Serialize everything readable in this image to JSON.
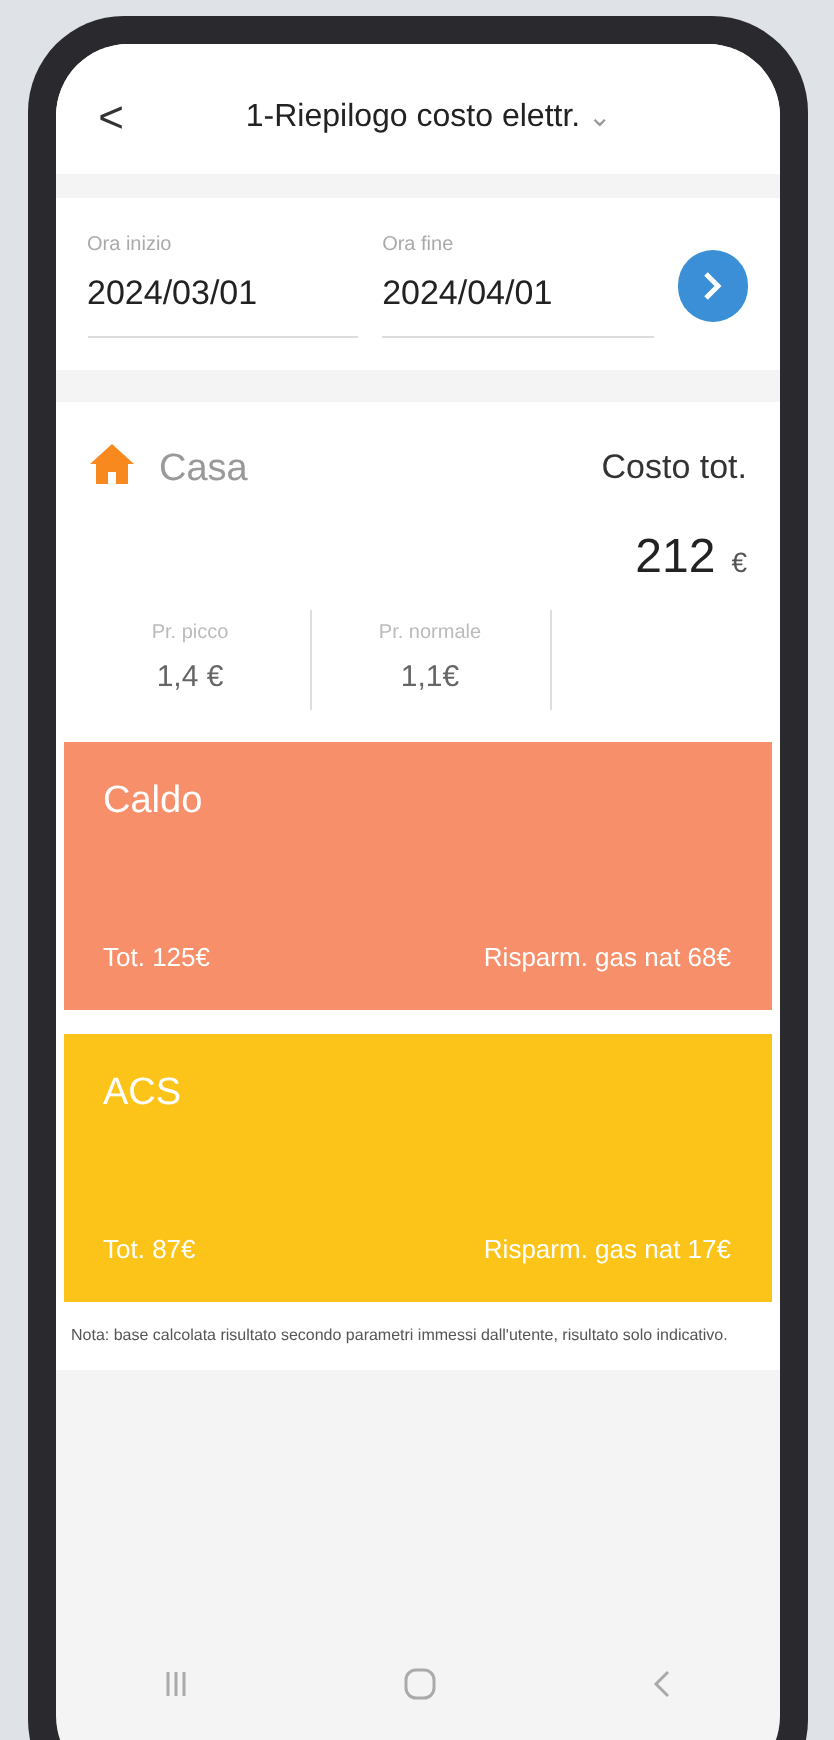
{
  "header": {
    "back": "<",
    "title": "1-Riepilogo costo elettr.",
    "dropdown": "⌄"
  },
  "dates": {
    "start": {
      "label": "Ora inizio",
      "value": "2024/03/01"
    },
    "end": {
      "label": "Ora fine",
      "value": "2024/04/01"
    }
  },
  "summary": {
    "name": "Casa",
    "total_label": "Costo tot.",
    "total_value": "212",
    "currency": "€"
  },
  "prices": [
    {
      "label": "Pr. picco",
      "value": "1,4 €"
    },
    {
      "label": "Pr. normale",
      "value": "1,1€"
    }
  ],
  "cards": [
    {
      "title": "Caldo",
      "total": "Tot. 125€",
      "saving": "Risparm. gas nat 68€",
      "color": "#f7906a"
    },
    {
      "title": "ACS",
      "total": "Tot. 87€",
      "saving": "Risparm. gas nat 17€",
      "color": "#fcc419"
    }
  ],
  "note": "Nota: base calcolata risultato secondo parametri immessi dall'utente, risultato solo indicativo."
}
